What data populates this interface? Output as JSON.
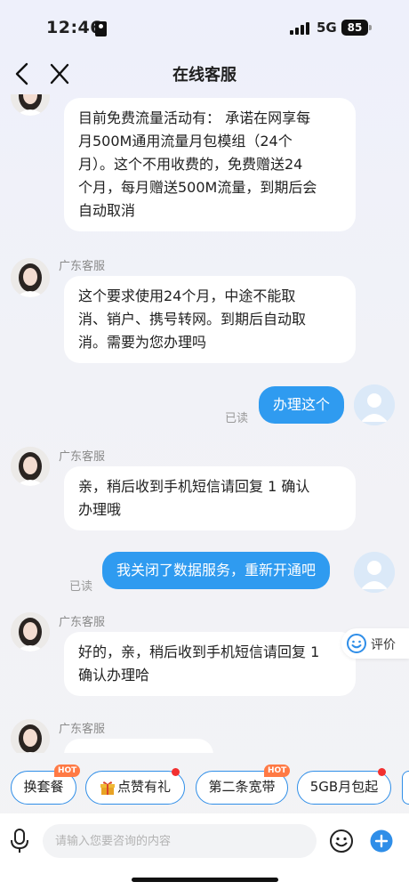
{
  "status_bar": {
    "time": "12:46",
    "network": "5G",
    "battery": "85"
  },
  "nav": {
    "title": "在线客服"
  },
  "messages": {
    "m1": {
      "lines": [
        "目前免费流量活动有： 承诺在网享每",
        "月500M通用流量月包模组（24个",
        "月）。这个不用收费的，免费赠送24",
        "个月，每月赠送500M流量，到期后会",
        "自动取消"
      ]
    },
    "m2": {
      "sender": "广东客服",
      "lines": [
        "这个要求使用24个月，中途不能取",
        "消、销户、携号转网。到期后自动取",
        "消。需要为您办理吗"
      ]
    },
    "m3": {
      "text": "办理这个",
      "status": "已读"
    },
    "m4": {
      "sender": "广东客服",
      "lines": [
        "亲，稍后收到手机短信请回复 1 确认",
        "办理哦"
      ]
    },
    "m5": {
      "text": "我关闭了数据服务，重新开通吧",
      "status": "已读"
    },
    "m6": {
      "sender": "广东客服",
      "lines": [
        "好的，亲，稍后收到手机短信请回复 1",
        "确认办理哈"
      ]
    },
    "m7": {
      "sender": "广东客服"
    }
  },
  "rate": {
    "label": "评价",
    "icon": "smile-icon"
  },
  "chips": {
    "c1": {
      "label": "换套餐",
      "badge": "HOT"
    },
    "c2": {
      "label": "点赞有礼",
      "icon": "gift-icon"
    },
    "c3": {
      "label": "第二条宽带",
      "badge": "HOT"
    },
    "c4": {
      "label": "5GB月包起"
    }
  },
  "input": {
    "placeholder": "请输入您要咨询的内容"
  },
  "colors": {
    "accent": "#2f9bf0",
    "chip_border": "#2f8ee8",
    "hot_badge": "#ff7a45",
    "red_dot": "#f23030"
  }
}
